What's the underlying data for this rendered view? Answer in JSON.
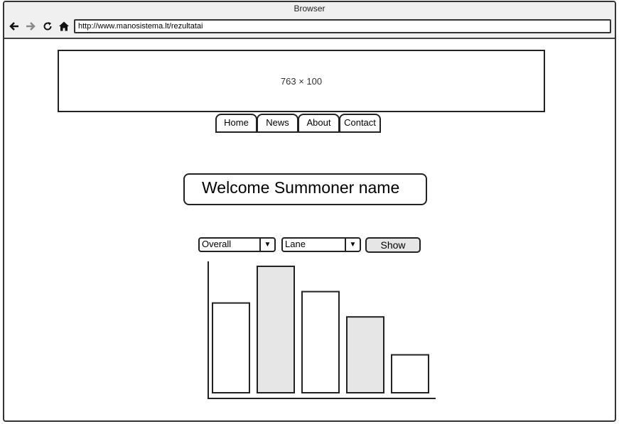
{
  "window": {
    "title": "Browser"
  },
  "toolbar": {
    "back_icon": "back-arrow-icon",
    "forward_icon": "forward-arrow-icon",
    "reload_icon": "reload-icon",
    "home_icon": "home-icon",
    "url": "http://www.manosistema.lt/rezultatai"
  },
  "banner": {
    "label": "763 × 100"
  },
  "nav": {
    "tabs": [
      {
        "label": "Home"
      },
      {
        "label": "News"
      },
      {
        "label": "About"
      },
      {
        "label": "Contact"
      }
    ]
  },
  "main": {
    "welcome": "Welcome Summoner name",
    "filter1": {
      "selected": "Overall"
    },
    "filter2": {
      "selected": "Lane"
    },
    "show_label": "Show"
  },
  "chart_data": {
    "type": "bar",
    "categories": [
      "",
      "",
      "",
      "",
      ""
    ],
    "values": [
      0.71,
      1.0,
      0.8,
      0.6,
      0.3
    ],
    "bar_fills": [
      "#ffffff",
      "#e6e6e6",
      "#ffffff",
      "#e6e6e6",
      "#ffffff"
    ],
    "title": "",
    "xlabel": "",
    "ylabel": "",
    "grid": false
  }
}
